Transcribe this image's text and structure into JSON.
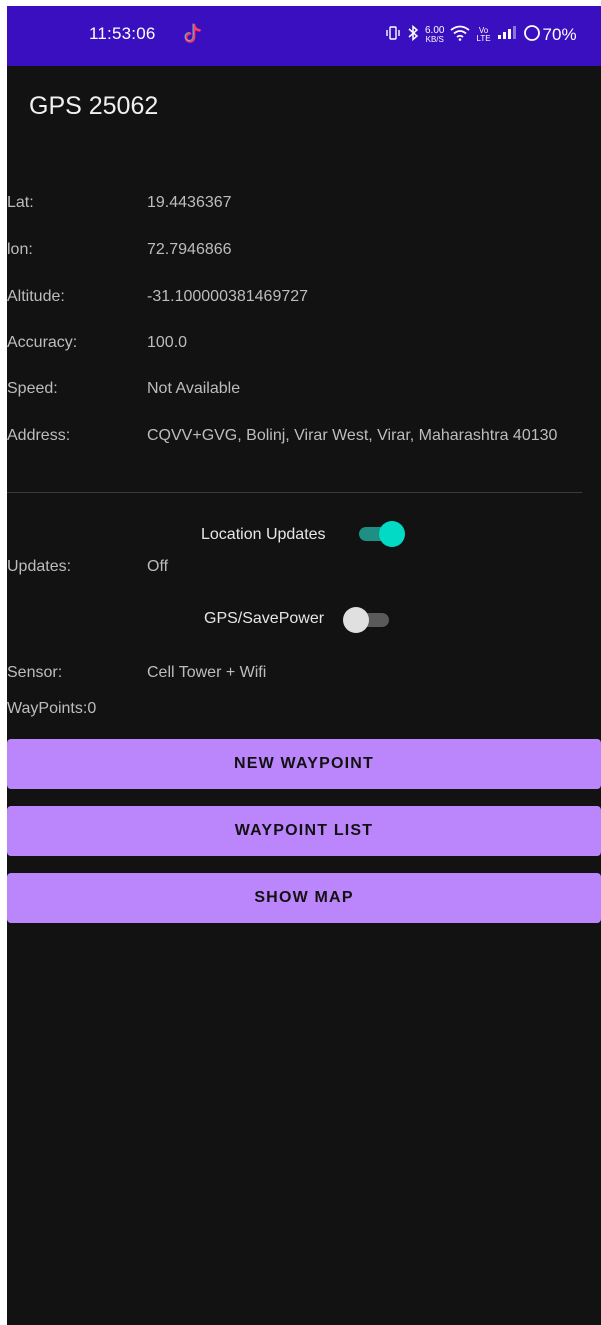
{
  "status_bar": {
    "time": "11:53:06",
    "net_speed_value": "6.00",
    "net_speed_unit": "KB/S",
    "volte_top": "Vo",
    "volte_bottom": "LTE",
    "battery": "70%",
    "background_color": "#3a0fbf",
    "icons": [
      "tiktok-icon",
      "vibrate-icon",
      "bluetooth-icon",
      "wifi-icon",
      "signal-icon",
      "battery-ring-icon"
    ]
  },
  "app": {
    "title": "GPS 25062"
  },
  "location": {
    "lat_label": "Lat:",
    "lat_value": "19.4436367",
    "lon_label": "lon:",
    "lon_value": "72.7946866",
    "altitude_label": "Altitude:",
    "altitude_value": "-31.100000381469727",
    "accuracy_label": "Accuracy:",
    "accuracy_value": "100.0",
    "speed_label": "Speed:",
    "speed_value": "Not Available",
    "address_label": "Address:",
    "address_value": "CQVV+GVG, Bolinj, Virar West, Virar, Maharashtra 40130"
  },
  "settings": {
    "location_updates_label": "Location Updates",
    "location_updates_on": true,
    "updates_label": "Updates:",
    "updates_value": "Off",
    "gps_savepower_label": "GPS/SavePower",
    "gps_savepower_on": false,
    "sensor_label": "Sensor:",
    "sensor_value": "Cell Tower + Wifi",
    "waypoints_text": "WayPoints:0"
  },
  "buttons": {
    "new_waypoint": "NEW WAYPOINT",
    "waypoint_list": "WAYPOINT LIST",
    "show_map": "SHOW MAP"
  },
  "colors": {
    "screen_background": "#121212",
    "button_background": "#bb86fc",
    "switch_on_thumb": "#03dac5",
    "switch_on_track": "#1f8f84",
    "switch_off_thumb": "#e0e0e0",
    "switch_off_track": "#5a5a5a"
  }
}
